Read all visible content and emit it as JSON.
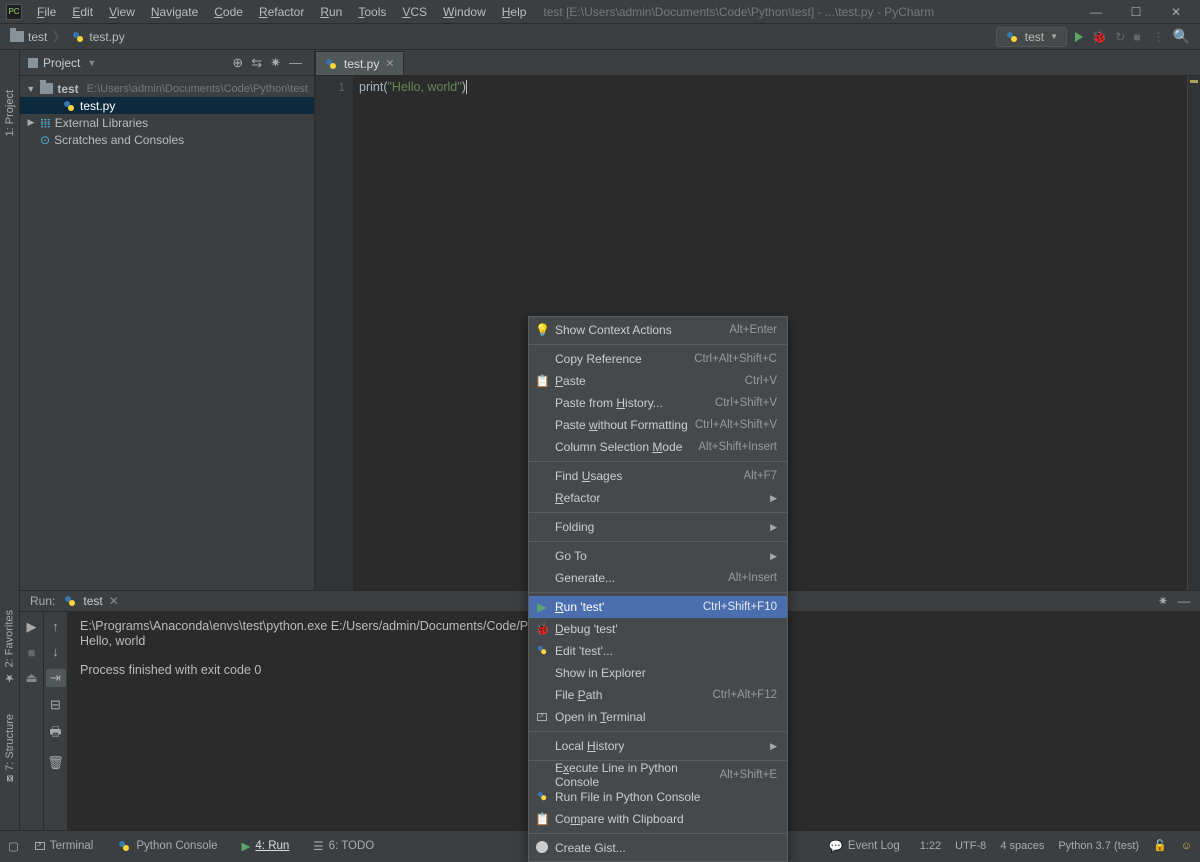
{
  "title_path": "test [E:\\Users\\admin\\Documents\\Code\\Python\\test] - ...\\test.py - PyCharm",
  "menubar": [
    "File",
    "Edit",
    "View",
    "Navigate",
    "Code",
    "Refactor",
    "Run",
    "Tools",
    "VCS",
    "Window",
    "Help"
  ],
  "breadcrumb": {
    "root": "test",
    "file": "test.py"
  },
  "run_config": "test",
  "project_panel": {
    "title": "Project",
    "tree": {
      "root": "test",
      "root_path": "E:\\Users\\admin\\Documents\\Code\\Python\\test",
      "file": "test.py",
      "ext_lib": "External Libraries",
      "scratch": "Scratches and Consoles"
    }
  },
  "editor": {
    "tab": "test.py",
    "line_no": "1",
    "code_fn": "print",
    "code_str": "\"Hello, world\""
  },
  "run_panel": {
    "label": "Run:",
    "tab": "test",
    "line1": "E:\\Programs\\Anaconda\\envs\\test\\python.exe E:/Users/admin/Documents/Code/Pyt",
    "line2": "Hello, world",
    "line3": "Process finished with exit code 0"
  },
  "bottom_tools": {
    "terminal": "Terminal",
    "py_console": "Python Console",
    "run": "4: Run",
    "todo": "6: TODO",
    "event_log": "Event Log"
  },
  "status": {
    "pos": "1:22",
    "enc": "UTF-8",
    "indent": "4 spaces",
    "interp": "Python 3.7 (test)"
  },
  "side_labels": {
    "project": "1: Project",
    "favorites": "2: Favorites",
    "structure": "7: Structure"
  },
  "ctx": [
    {
      "label": "Show Context Actions",
      "sc": "Alt+Enter",
      "icon": "bulb"
    },
    {
      "sep": true
    },
    {
      "label": "Copy Reference",
      "sc": "Ctrl+Alt+Shift+C"
    },
    {
      "label": "Paste",
      "sc": "Ctrl+V",
      "icon": "clip",
      "u": 0
    },
    {
      "label": "Paste from History...",
      "sc": "Ctrl+Shift+V",
      "u": 11
    },
    {
      "label": "Paste without Formatting",
      "sc": "Ctrl+Alt+Shift+V",
      "u": 6
    },
    {
      "label": "Column Selection Mode",
      "sc": "Alt+Shift+Insert",
      "u": 17
    },
    {
      "sep": true
    },
    {
      "label": "Find Usages",
      "sc": "Alt+F7",
      "u": 5
    },
    {
      "label": "Refactor",
      "sub": true,
      "u": 0
    },
    {
      "sep": true
    },
    {
      "label": "Folding",
      "sub": true
    },
    {
      "sep": true
    },
    {
      "label": "Go To",
      "sub": true
    },
    {
      "label": "Generate...",
      "sc": "Alt+Insert"
    },
    {
      "sep": true
    },
    {
      "label": "Run 'test'",
      "sc": "Ctrl+Shift+F10",
      "icon": "play",
      "sel": true,
      "u": 0
    },
    {
      "label": "Debug 'test'",
      "icon": "bug",
      "u": 0
    },
    {
      "label": "Edit 'test'...",
      "icon": "python"
    },
    {
      "label": "Show in Explorer"
    },
    {
      "label": "File Path",
      "sc": "Ctrl+Alt+F12",
      "u": 5
    },
    {
      "label": "Open in Terminal",
      "icon": "term",
      "u": 8
    },
    {
      "sep": true
    },
    {
      "label": "Local History",
      "sub": true,
      "u": 6
    },
    {
      "sep": true
    },
    {
      "label": "Execute Line in Python Console",
      "sc": "Alt+Shift+E",
      "u": 1
    },
    {
      "label": "Run File in Python Console",
      "icon": "python"
    },
    {
      "label": "Compare with Clipboard",
      "icon": "clip",
      "u": 2
    },
    {
      "sep": true
    },
    {
      "label": "Create Gist...",
      "icon": "gh"
    }
  ]
}
